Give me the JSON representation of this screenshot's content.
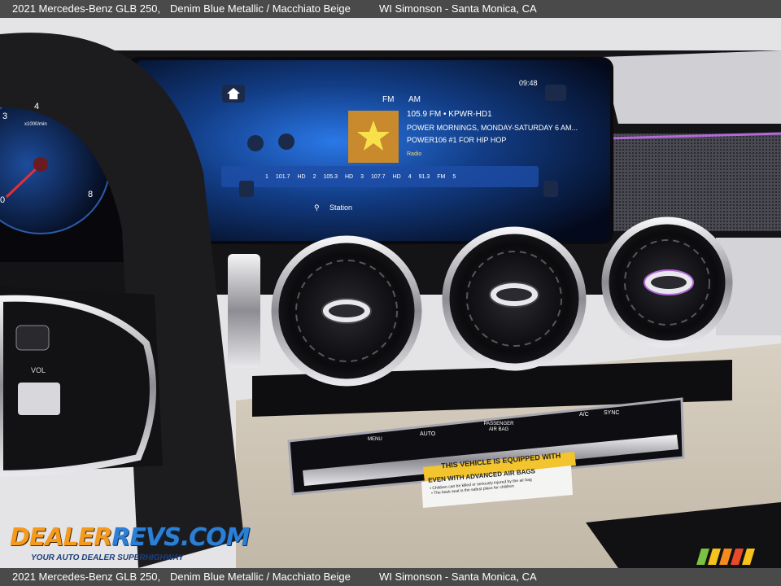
{
  "caption": {
    "vehicle": "2021 Mercedes-Benz GLB 250,",
    "colors": "Denim Blue Metallic / Macchiato Beige",
    "dealer": "WI Simonson - Santa Monica, CA"
  },
  "screen": {
    "time": "09:48",
    "band_fm": "FM",
    "band_am": "AM",
    "station_line": "105.9 FM • KPWR-HD1",
    "show_line": "POWER MORNINGS, MONDAY-SATURDAY 6 AM...",
    "slogan_line": "POWER106 #1 FOR HIP HOP",
    "presets": [
      "1",
      "101.7",
      "HD",
      "2",
      "105.3",
      "HD",
      "3",
      "107.7",
      "HD",
      "4",
      "91.3",
      "FM",
      "5"
    ],
    "station_button": "Station",
    "radio_brand": "Radio"
  },
  "cluster": {
    "unit": "x1000/min",
    "ticks": [
      "3",
      "4",
      "8",
      "0"
    ]
  },
  "steering": {
    "vol_label": "VOL"
  },
  "climate": {
    "labels": [
      "MENU",
      "AUTO",
      "PASSENGER AIR BAG",
      "A/C",
      "SYNC"
    ]
  },
  "sticker": {
    "title": "THIS VEHICLE IS EQUIPPED WITH",
    "subtitle": "EVEN WITH ADVANCED AIR BAGS",
    "line1": "• Children can be killed or seriously injured by the air bag",
    "line2": "• The back seat is the safest place for children"
  },
  "watermark": {
    "logo_part1": "DEALER",
    "logo_part2": "REVS.COM",
    "tagline": "YOUR AUTO DEALER SUPERHIGHWAY"
  },
  "colors": {
    "caption_bg": "#4a4a4a",
    "screen_blue": "#1e6fd8",
    "ambient_purple": "#b36ad8",
    "sticker_yellow": "#f2c42e",
    "logo_orange": "#f39a1f",
    "logo_blue": "#2b7fd4"
  }
}
